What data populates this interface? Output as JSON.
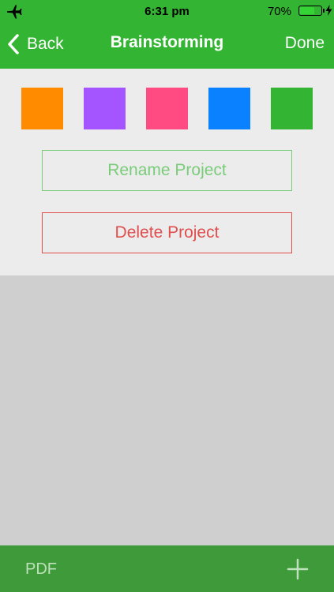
{
  "status_bar": {
    "time": "6:31 pm",
    "battery_percent": "70%",
    "battery_level": 0.7,
    "icons": [
      "airplane-icon",
      "battery-icon",
      "charging-bolt-icon"
    ]
  },
  "nav": {
    "back_label": "Back",
    "title": "Brainstorming",
    "done_label": "Done",
    "icons": [
      "chevron-left-icon"
    ]
  },
  "colors": {
    "header_green": "#33B533",
    "toolbar_green": "#3F9A3A",
    "panel_background": "#ECECEC",
    "content_background": "#CFCFCF",
    "rename_green": "#7ACC7A",
    "delete_red": "#E04E4E"
  },
  "swatches": [
    {
      "name": "orange",
      "color": "#FF8C00"
    },
    {
      "name": "purple",
      "color": "#A455FF"
    },
    {
      "name": "pink",
      "color": "#FF4B82"
    },
    {
      "name": "blue",
      "color": "#0A82FF"
    },
    {
      "name": "green",
      "color": "#33B533"
    }
  ],
  "actions": {
    "rename_label": "Rename Project",
    "delete_label": "Delete Project"
  },
  "toolbar": {
    "pdf_label": "PDF",
    "icons": [
      "plus-icon"
    ]
  }
}
